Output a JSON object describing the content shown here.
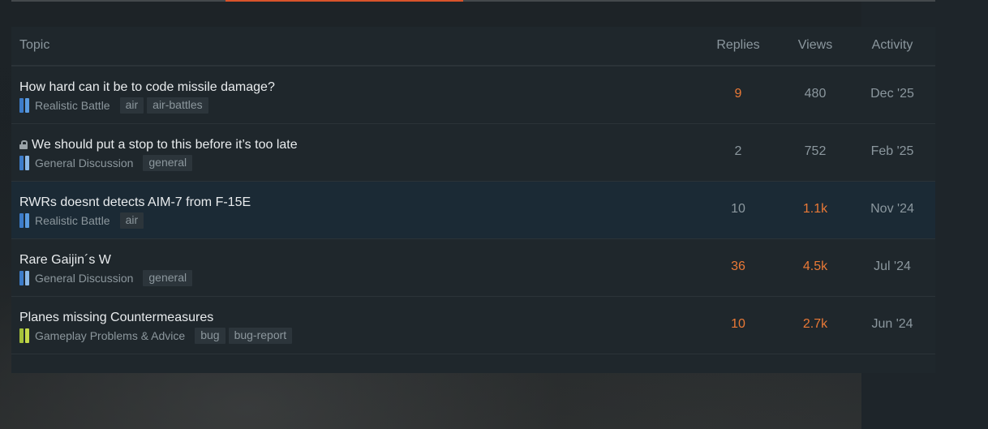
{
  "progress": {
    "fill_fraction": 0.257,
    "offset_fraction": 0.232,
    "color": "#d9542b"
  },
  "columns": {
    "topic": "Topic",
    "replies": "Replies",
    "views": "Views",
    "activity": "Activity"
  },
  "colors": {
    "hot": "#ea7936",
    "muted": "#8b979e",
    "realistic_battle": "#4a8fd6",
    "general_discussion": "#5e9ad8",
    "gameplay_problems": "#9cc23a"
  },
  "topics": [
    {
      "title": "How hard can it be to code missile damage?",
      "locked": false,
      "category": "Realistic Battle",
      "category_colors": [
        "#3d7cc9",
        "#5a9be0"
      ],
      "tags": [
        "air",
        "air-battles"
      ],
      "replies": "9",
      "replies_hot": true,
      "views": "480",
      "views_hot": false,
      "activity": "Dec '25",
      "highlight": false
    },
    {
      "title": "We should put a stop to this before it’s too late",
      "locked": true,
      "category": "General Discussion",
      "category_colors": [
        "#3d7cc9",
        "#8ab8e8"
      ],
      "tags": [
        "general"
      ],
      "replies": "2",
      "replies_hot": false,
      "views": "752",
      "views_hot": false,
      "activity": "Feb '25",
      "highlight": false
    },
    {
      "title": "RWRs doesnt detects AIM-7 from F-15E",
      "locked": false,
      "category": "Realistic Battle",
      "category_colors": [
        "#3d7cc9",
        "#5a9be0"
      ],
      "tags": [
        "air"
      ],
      "replies": "10",
      "replies_hot": false,
      "views": "1.1k",
      "views_hot": true,
      "activity": "Nov '24",
      "highlight": true
    },
    {
      "title": "Rare Gaijin´s W",
      "locked": false,
      "category": "General Discussion",
      "category_colors": [
        "#3d7cc9",
        "#8ab8e8"
      ],
      "tags": [
        "general"
      ],
      "replies": "36",
      "replies_hot": true,
      "views": "4.5k",
      "views_hot": true,
      "activity": "Jul '24",
      "highlight": false
    },
    {
      "title": "Planes missing Countermeasures",
      "locked": false,
      "category": "Gameplay Problems & Advice",
      "category_colors": [
        "#a5c23a",
        "#c4d94a"
      ],
      "tags": [
        "bug",
        "bug-report"
      ],
      "replies": "10",
      "replies_hot": true,
      "views": "2.7k",
      "views_hot": true,
      "activity": "Jun '24",
      "highlight": false
    }
  ]
}
